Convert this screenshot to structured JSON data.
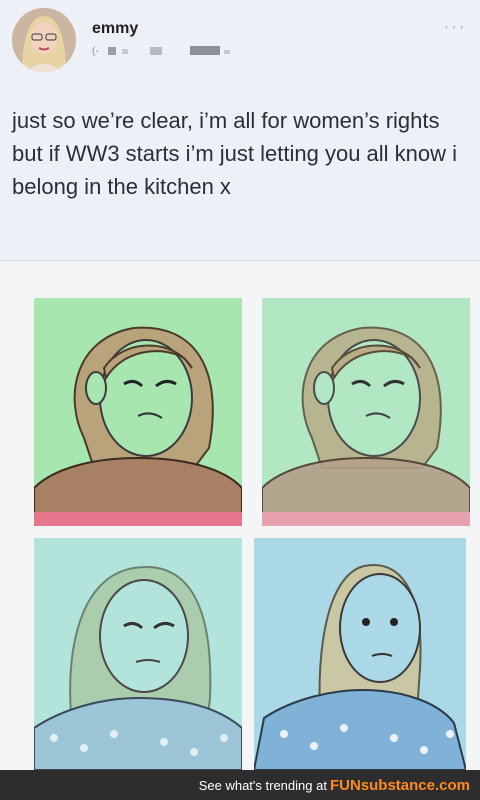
{
  "post": {
    "username": "emmy",
    "handle_partial": "(-",
    "more_icon": "more-dots-icon",
    "text": "just so we’re clear, i’m all for women’s rights but if WW3 starts i’m just letting you all know i belong in the kitchen x"
  },
  "meme": {
    "panels": [
      {
        "id": "top-left",
        "bg": "#a8e6b0"
      },
      {
        "id": "top-right",
        "bg": "#b1e7c3"
      },
      {
        "id": "bottom-left",
        "bg": "#b2e4dc"
      },
      {
        "id": "bottom-right",
        "bg": "#aad8e6"
      }
    ]
  },
  "footer": {
    "text": "See what's trending at",
    "brand": "FUNsubstance.com"
  },
  "colors": {
    "accent": "#ff8a1e",
    "footer_bg": "#2d2d2d",
    "page_bg": "#eef0f7"
  }
}
